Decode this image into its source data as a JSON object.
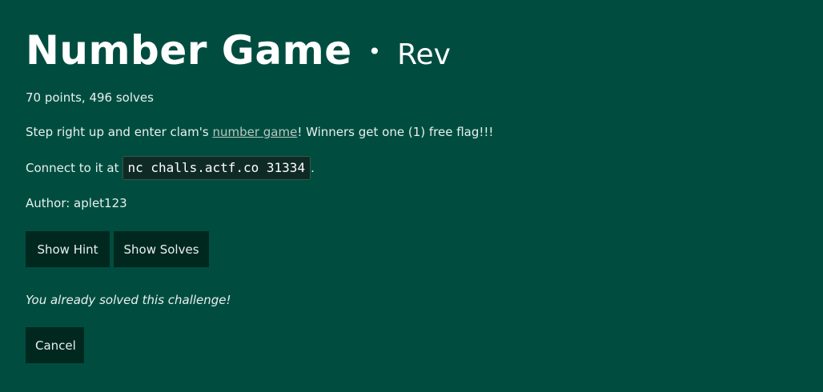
{
  "challenge": {
    "title": "Number Game",
    "separator": "•",
    "category": "Rev",
    "meta": "70 points, 496 solves",
    "description_prefix": "Step right up and enter clam's ",
    "description_link": "number game",
    "description_suffix": "! Winners get one (1) free flag!!!",
    "connect_prefix": "Connect to it at ",
    "connect_command": "nc challs.actf.co 31334",
    "connect_suffix": ".",
    "author": "Author: aplet123",
    "solved_message": "You already solved this challenge!"
  },
  "buttons": {
    "show_hint": "Show Hint",
    "show_solves": "Show Solves",
    "cancel": "Cancel"
  },
  "colors": {
    "background": "#004d40",
    "button_bg": "#00281f",
    "code_bg": "#0f2a24"
  }
}
